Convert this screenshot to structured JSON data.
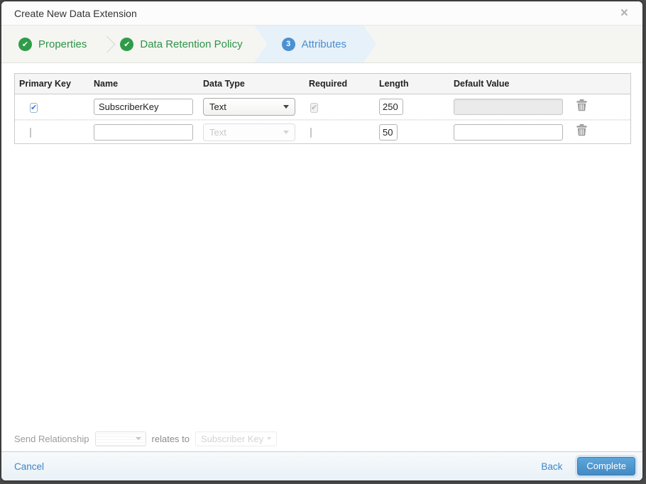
{
  "dialog": {
    "title": "Create New Data Extension"
  },
  "glyphs": {
    "close": "×",
    "check": "✔"
  },
  "wizard": {
    "steps": [
      {
        "label": "Properties",
        "state": "complete"
      },
      {
        "label": "Data Retention Policy",
        "state": "complete"
      },
      {
        "label": "Attributes",
        "state": "active",
        "number": "3"
      }
    ]
  },
  "table": {
    "headers": [
      "Primary Key",
      "Name",
      "Data Type",
      "Required",
      "Length",
      "Default Value"
    ],
    "rows": [
      {
        "primary_key_checked": true,
        "name": "SubscriberKey",
        "data_type": "Text",
        "data_type_enabled": true,
        "required_checked": true,
        "required_enabled": false,
        "length": "250",
        "default_value": "",
        "default_enabled": false
      },
      {
        "primary_key_checked": false,
        "name": "",
        "data_type": "Text",
        "data_type_enabled": false,
        "required_checked": false,
        "required_enabled": true,
        "length": "50",
        "default_value": "",
        "default_enabled": true
      }
    ]
  },
  "send_relationship": {
    "label": "Send Relationship",
    "relates_to": "relates to",
    "target_field": "Subscriber Key"
  },
  "footer": {
    "cancel": "Cancel",
    "back": "Back",
    "complete": "Complete"
  },
  "colors": {
    "step_complete_green": "#2f9c49",
    "step_active_blue": "#4a90d2",
    "active_step_bg": "#e7f1f9",
    "link_blue": "#3e86c6",
    "button_blue_top": "#5ea6da",
    "button_blue_bottom": "#4389c4"
  }
}
